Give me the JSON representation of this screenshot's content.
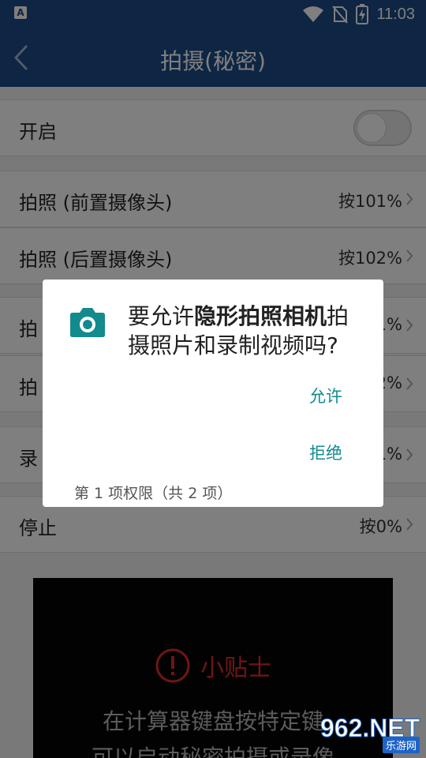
{
  "status_bar": {
    "left_badge": "A",
    "time": "11:03",
    "icons": [
      "wifi-icon",
      "no-sim-icon",
      "battery-charging-icon"
    ]
  },
  "app_bar": {
    "title": "拍摄(秘密)",
    "back_icon": "chevron-left-icon"
  },
  "settings": {
    "enable_label": "开启",
    "enable_on": false,
    "rows": [
      {
        "label": "拍照 (前置摄像头)",
        "value": "按101%"
      },
      {
        "label": "拍照 (后置摄像头)",
        "value": "按102%"
      },
      {
        "label": "拍",
        "value": "1%"
      },
      {
        "label": "拍",
        "value": "2%"
      },
      {
        "label": "录",
        "value": "1%"
      },
      {
        "label": "停止",
        "value": "按0%"
      }
    ]
  },
  "tips": {
    "title": "小贴士",
    "icon": "alert-circle-icon",
    "line1": "在计算器键盘按特定键",
    "line2": "可以启动秘密拍摄或录像"
  },
  "dialog": {
    "icon": "camera-icon",
    "message_prefix": "要允许",
    "app_name": "隐形拍照相机",
    "message_suffix": "拍摄照片和录制视频吗?",
    "allow_label": "允许",
    "deny_label": "拒绝",
    "footer": "第 1 项权限（共 2 项）"
  },
  "watermark": {
    "number": "962.NET",
    "caption": "乐游网"
  },
  "colors": {
    "primary": "#1c4b86",
    "accent": "#138a8e",
    "tips_red": "#e32b2b"
  }
}
